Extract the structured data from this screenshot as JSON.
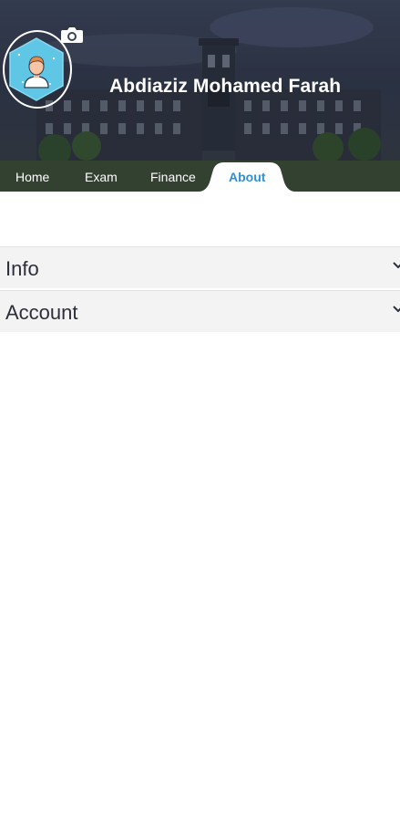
{
  "profile": {
    "name": "Abdiaziz Mohamed Farah",
    "avatar_icon": "user-avatar-icon",
    "camera_icon": "camera-icon"
  },
  "tabs": [
    {
      "label": "Home",
      "active": false
    },
    {
      "label": "Exam",
      "active": false
    },
    {
      "label": "Finance",
      "active": false
    },
    {
      "label": "About",
      "active": true
    }
  ],
  "sections": [
    {
      "label": "Info",
      "icon": "chevron-down-icon"
    },
    {
      "label": "Account",
      "icon": "chevron-down-icon"
    }
  ],
  "colors": {
    "accent": "#2f8fd6",
    "section_bg": "#f3f3f4",
    "avatar_bg": "#5fc6e6"
  }
}
